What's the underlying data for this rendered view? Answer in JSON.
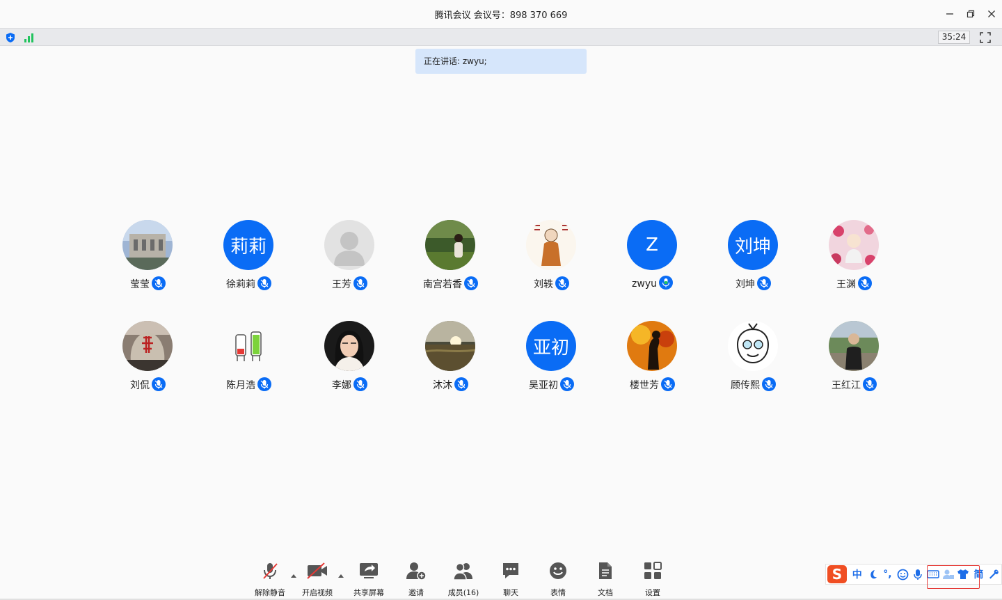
{
  "window": {
    "title": "腾讯会议 会议号：898 370 669"
  },
  "status": {
    "timer": "35:24"
  },
  "speaking": {
    "label": "正在讲话: zwyu;"
  },
  "participants": [
    {
      "name": "莹莹",
      "avatar": "photo-building",
      "mic": "muted"
    },
    {
      "name": "徐莉莉",
      "avatar_text": "莉莉",
      "mic": "muted"
    },
    {
      "name": "王芳",
      "avatar": "default-person",
      "mic": "muted"
    },
    {
      "name": "南宫若香",
      "avatar": "photo-woman-grass",
      "mic": "muted"
    },
    {
      "name": "刘轶",
      "avatar": "photo-monk-drawing",
      "mic": "muted"
    },
    {
      "name": "zwyu",
      "avatar_text": "Z",
      "mic": "speaking"
    },
    {
      "name": "刘坤",
      "avatar_text": "刘坤",
      "mic": "muted"
    },
    {
      "name": "王渊",
      "avatar": "photo-flowers-figure",
      "mic": "muted"
    },
    {
      "name": "刘侃",
      "avatar": "photo-stone-monument",
      "mic": "muted"
    },
    {
      "name": "陈月浩",
      "avatar": "photo-batteries-cartoon",
      "mic": "muted"
    },
    {
      "name": "李娜",
      "avatar": "photo-woman-portrait",
      "mic": "muted"
    },
    {
      "name": "沐沐",
      "avatar": "photo-sunset-field",
      "mic": "muted"
    },
    {
      "name": "吴亚初",
      "avatar_text": "亚初",
      "mic": "muted"
    },
    {
      "name": "楼世芳",
      "avatar": "photo-orange-silhouette",
      "mic": "muted"
    },
    {
      "name": "顾传熙",
      "avatar": "photo-cartoon-face",
      "mic": "muted"
    },
    {
      "name": "王红江",
      "avatar": "photo-man-outdoors",
      "mic": "muted"
    }
  ],
  "toolbar": {
    "unmute": "解除静音",
    "video": "开启视频",
    "share": "共享屏幕",
    "invite": "邀请",
    "members": "成员(16)",
    "chat": "聊天",
    "emoji": "表情",
    "docs": "文档",
    "settings": "设置"
  },
  "ime": {
    "logo": "S",
    "mode": "中",
    "punct": "°,",
    "simplified": "简"
  },
  "colors": {
    "accent": "#0a6cf5",
    "speaking_bg": "#d6e6fb",
    "mic_active": "#22c35e",
    "ime_red": "#f04e23"
  }
}
